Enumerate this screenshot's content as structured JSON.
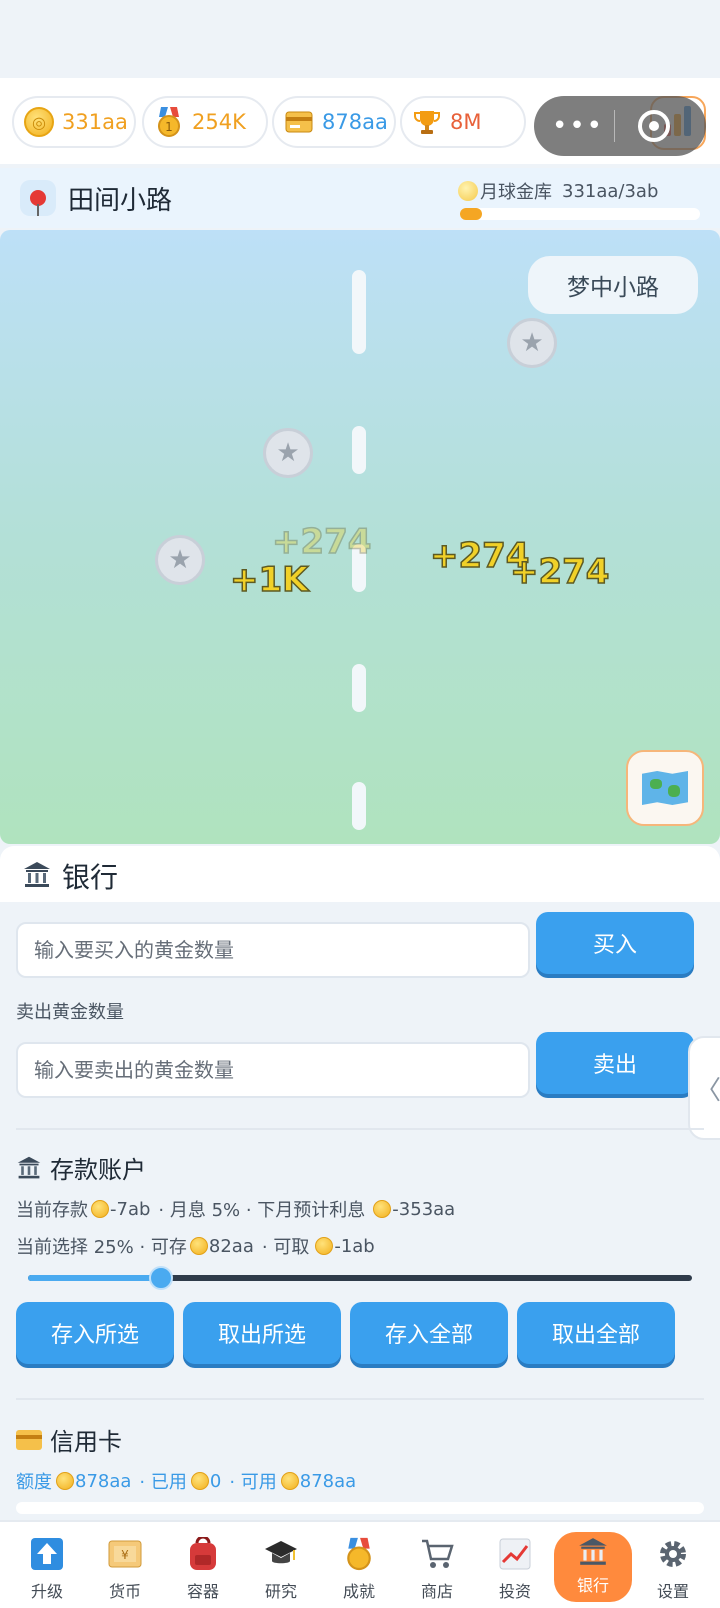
{
  "stats": {
    "coins": "331aa",
    "medals": "254K",
    "card": "878aa",
    "trophy": "8M"
  },
  "location": {
    "name": "田间小路",
    "vault_label": "月球金库",
    "vault_value": "331aa/3ab",
    "vault_progress": 0.09
  },
  "scene": {
    "dream_button": "梦中小路",
    "floaters": [
      "+274",
      "+1K",
      "+274",
      "+274"
    ]
  },
  "bank": {
    "title": "银行",
    "buy_placeholder": "输入要买入的黄金数量",
    "buy_button": "买入",
    "sell_label": "卖出黄金数量",
    "sell_placeholder": "输入要卖出的黄金数量",
    "sell_button": "卖出"
  },
  "deposit": {
    "title": "存款账户",
    "current_label": "当前存款",
    "current_value": "-7ab",
    "rate_text": "· 月息 5% · 下月预计利息",
    "interest_value": "-353aa",
    "select_label": "当前选择 25% · 可存",
    "can_deposit": "82aa",
    "withdraw_label": "· 可取",
    "can_withdraw": "-1ab",
    "slider_value": 0.2,
    "buttons": [
      "存入所选",
      "取出所选",
      "存入全部",
      "取出全部"
    ]
  },
  "credit": {
    "title": "信用卡",
    "limit_label": "额度",
    "limit_value": "878aa",
    "used_label": "· 已用",
    "used_value": "0",
    "available_label": "· 可用",
    "available_value": "878aa"
  },
  "side_handle": "〈",
  "nav": {
    "items": [
      "升级",
      "货币",
      "容器",
      "研究",
      "成就",
      "商店",
      "投资",
      "银行",
      "设置"
    ],
    "active_index": 7
  },
  "colors": {
    "accent": "#3aa0ee",
    "active_nav": "#ff8a3d",
    "coin_text": "#f0a020",
    "medal_text": "#f0a020",
    "card_text": "#3a9ae6",
    "trophy_text": "#e8613a"
  }
}
